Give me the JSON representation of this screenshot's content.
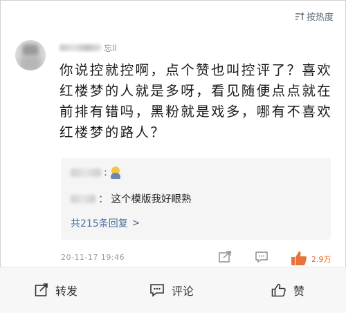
{
  "sort": {
    "label": "按热度",
    "icon": "sort-icon"
  },
  "comment": {
    "username_suffix": "忘ll",
    "text": "你说控就控啊，点个赞也叫控评了？喜欢红楼梦的人就是多呀，看见随便点点就在前排有错吗，黑粉就是戏多，哪有不喜欢红楼梦的路人？",
    "timestamp": "20-11-17 19:46",
    "like_count": "2.9万"
  },
  "replies": [
    {
      "colon": ":",
      "text": "",
      "emoji": "person-emoji"
    },
    {
      "colon": "：",
      "text": "这个模版我好眼熟"
    }
  ],
  "more_replies": {
    "label": "共215条回复",
    "chevron": ">"
  },
  "actions": {
    "forward": "转发",
    "comment": "评论",
    "like": "赞"
  },
  "colors": {
    "accent_blue": "#4a6d99",
    "like_orange": "#e26a2c"
  }
}
